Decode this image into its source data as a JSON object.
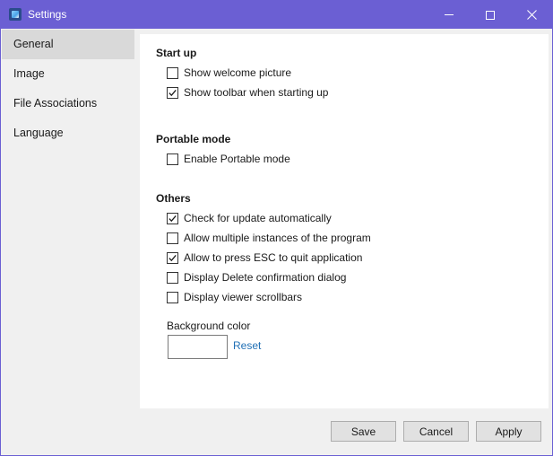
{
  "window": {
    "title": "Settings"
  },
  "sidebar": {
    "items": [
      {
        "label": "General"
      },
      {
        "label": "Image"
      },
      {
        "label": "File Associations"
      },
      {
        "label": "Language"
      }
    ],
    "selected": "General"
  },
  "sections": {
    "startup": {
      "title": "Start up",
      "options": [
        {
          "label": "Show welcome picture",
          "checked": false
        },
        {
          "label": "Show toolbar when starting up",
          "checked": true
        }
      ]
    },
    "portable": {
      "title": "Portable mode",
      "options": [
        {
          "label": "Enable Portable mode",
          "checked": false
        }
      ]
    },
    "others": {
      "title": "Others",
      "options": [
        {
          "label": "Check for update automatically",
          "checked": true
        },
        {
          "label": "Allow multiple instances of the program",
          "checked": false
        },
        {
          "label": "Allow to press ESC to quit application",
          "checked": true
        },
        {
          "label": "Display Delete confirmation dialog",
          "checked": false
        },
        {
          "label": "Display viewer scrollbars",
          "checked": false
        }
      ]
    }
  },
  "background": {
    "label": "Background color",
    "color": "#ffffff",
    "reset_label": "Reset"
  },
  "buttons": {
    "save": "Save",
    "cancel": "Cancel",
    "apply": "Apply"
  },
  "colors": {
    "titlebar": "#6b5fd3",
    "sidebar_selected": "#d9d9d9",
    "link": "#1f6fb5"
  }
}
